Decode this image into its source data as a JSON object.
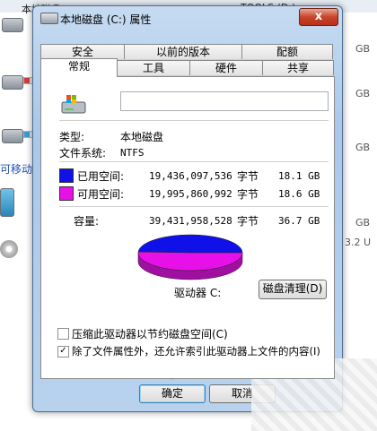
{
  "background": {
    "title": "本地磁盘 (C:)",
    "tools_drive": "TOOLS (D:)",
    "side_label": "可移动",
    "right_sizes": [
      "GB",
      "GB",
      "GB",
      "3.2 U",
      "GB"
    ]
  },
  "dialog": {
    "title": "本地磁盘 (C:) 属性",
    "close_label": "x",
    "tabs_row1": [
      "安全",
      "以前的版本",
      "配额"
    ],
    "tabs_row2": [
      "常规",
      "工具",
      "硬件",
      "共享"
    ],
    "drive_name_value": "",
    "type_label": "类型:",
    "type_value": "本地磁盘",
    "fs_label": "文件系统:",
    "fs_value": "NTFS",
    "used": {
      "label": "已用空间:",
      "bytes": "19,436,097,536",
      "unit": "字节",
      "size": "18.1 GB",
      "color": "#1010e8"
    },
    "free": {
      "label": "可用空间:",
      "bytes": "19,995,860,992",
      "unit": "字节",
      "size": "18.6 GB",
      "color": "#e810e8"
    },
    "capacity": {
      "label": "容量:",
      "bytes": "39,431,958,528",
      "unit": "字节",
      "size": "36.7 GB"
    },
    "pie_used_fraction": 0.493,
    "drive_label": "驱动器 C:",
    "cleanup_button": "磁盘清理(D)",
    "compress_label": "压缩此驱动器以节约磁盘空间(C)",
    "compress_checked": false,
    "index_label": "除了文件属性外，还允许索引此驱动器上文件的内容(I)",
    "index_checked": true,
    "ok_button": "确定",
    "cancel_button": "取消"
  },
  "colors": {
    "annotation_arrow": "#d8241c"
  }
}
